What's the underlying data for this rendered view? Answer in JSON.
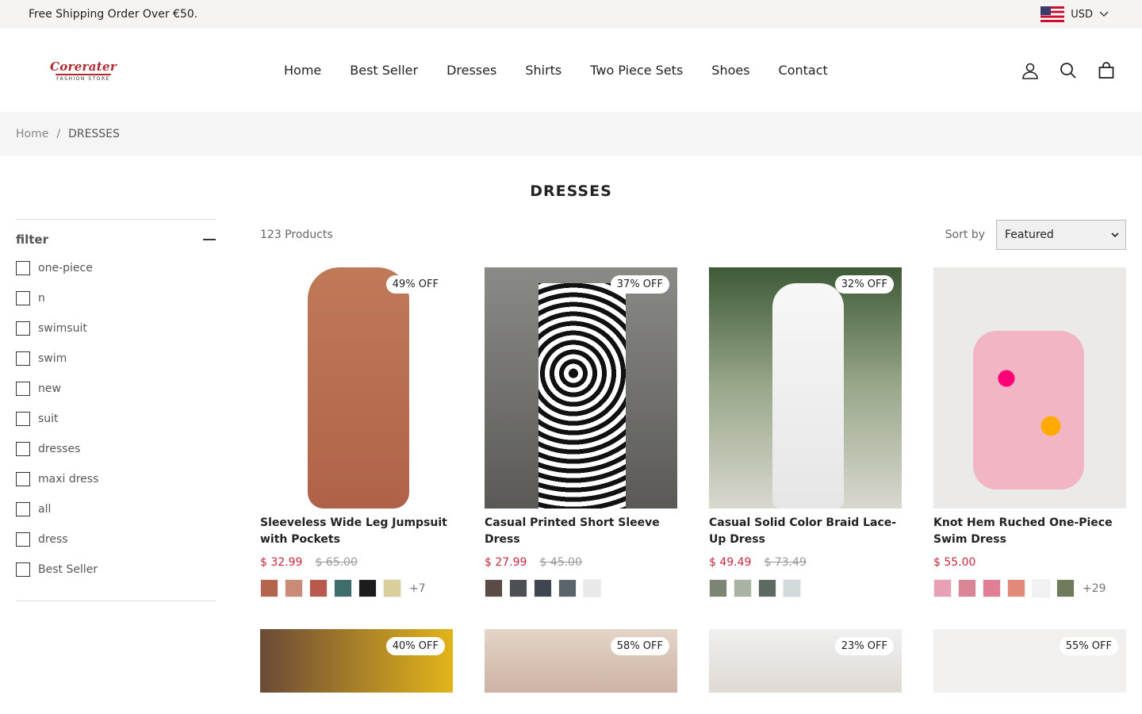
{
  "announcement": "Free Shipping Order Over €50.",
  "currency": "USD",
  "logo": {
    "name": "Corerater",
    "tagline": "FASHION STORE"
  },
  "nav": [
    "Home",
    "Best Seller",
    "Dresses",
    "Shirts",
    "Two Piece Sets",
    "Shoes",
    "Contact"
  ],
  "breadcrumb": {
    "home": "Home",
    "separator": "/",
    "current": "DRESSES"
  },
  "page_title": "DRESSES",
  "filter": {
    "title": "filter",
    "options": [
      "one-piece",
      "n",
      "swimsuit",
      "swim",
      "new",
      "suit",
      "dresses",
      "maxi dress",
      "all",
      "dress",
      "Best Seller"
    ]
  },
  "product_count": "123 Products",
  "sort": {
    "label": "Sort by",
    "value": "Featured"
  },
  "products": [
    {
      "badge": "49% OFF",
      "name": "Sleeveless Wide Leg Jumpsuit with Pockets",
      "price": "$ 32.99",
      "old_price": "$ 65.00",
      "more": "+7",
      "swatches": [
        "#b5654c",
        "#c98a78",
        "#b9584d",
        "#3f6d6b",
        "#1c1c1c",
        "#d8cf9a"
      ]
    },
    {
      "badge": "37% OFF",
      "name": "Casual Printed Short Sleeve Dress",
      "price": "$ 27.99",
      "old_price": "$ 45.00",
      "more": "",
      "swatches": [
        "#5a4b45",
        "#4d4f55",
        "#3f4650",
        "#5a646b",
        "#e9e9e9"
      ]
    },
    {
      "badge": "32% OFF",
      "name": "Casual Solid Color Braid Lace-Up Dress",
      "price": "$ 49.49",
      "old_price": "$ 73.49",
      "more": "",
      "swatches": [
        "#7b8574",
        "#a9b2a3",
        "#5c6a62",
        "#d3dadb"
      ]
    },
    {
      "badge": "",
      "name": "Knot Hem Ruched One-Piece Swim Dress",
      "price": "$ 55.00",
      "old_price": "",
      "more": "+29",
      "swatches": [
        "#e8a0b4",
        "#d98595",
        "#e07e95",
        "#e2897a",
        "#f2f2f4",
        "#6e7a5a"
      ]
    }
  ],
  "products_row2": [
    {
      "badge": "40% OFF"
    },
    {
      "badge": "58% OFF"
    },
    {
      "badge": "23% OFF"
    },
    {
      "badge": "55% OFF"
    }
  ]
}
